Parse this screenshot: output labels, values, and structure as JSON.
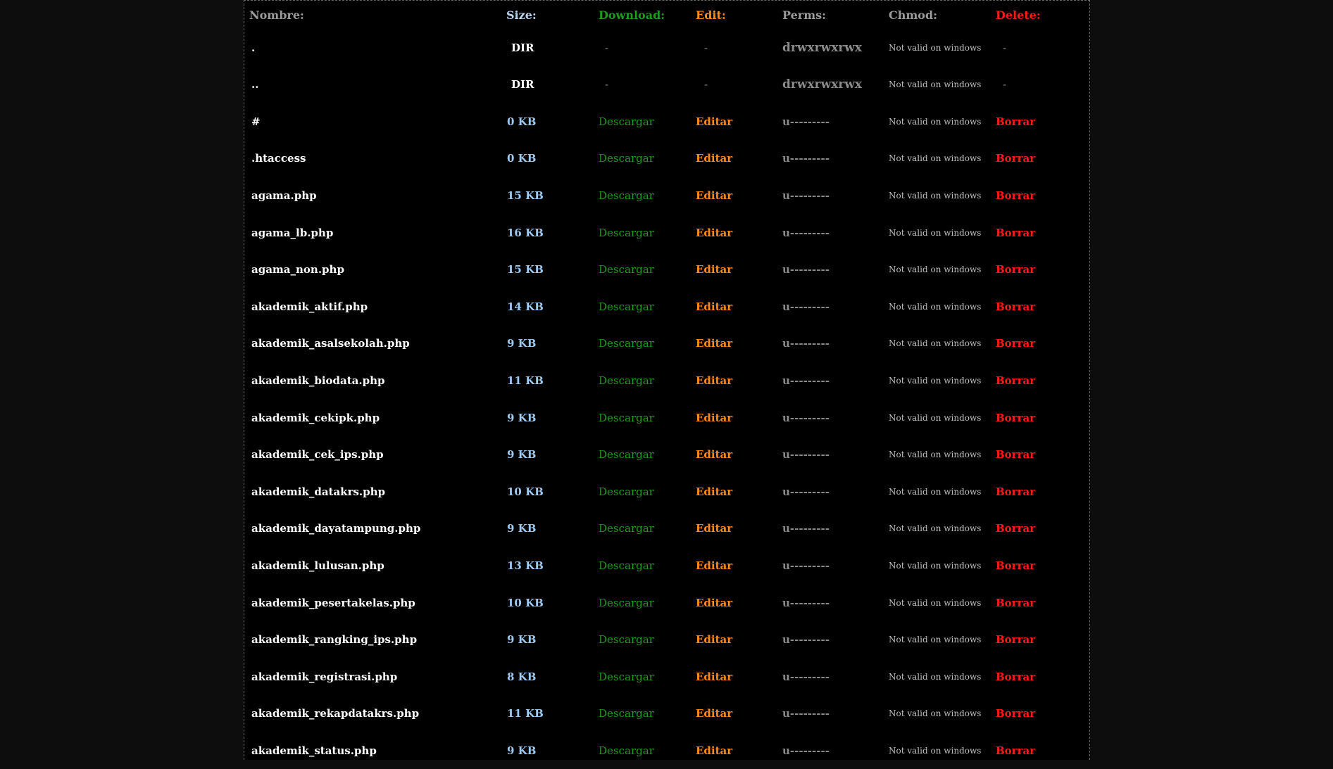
{
  "headers": {
    "name": "Nombre:",
    "size": "Size:",
    "download": "Download:",
    "edit": "Edit:",
    "perms": "Perms:",
    "chmod": "Chmod:",
    "delete": "Delete:"
  },
  "rows": [
    {
      "name": ".",
      "size": "DIR",
      "download": "-",
      "edit": "-",
      "perms": "drwxrwxrwx",
      "chmod": "Not valid on windows",
      "delete": "-"
    },
    {
      "name": "..",
      "size": "DIR",
      "download": "-",
      "edit": "-",
      "perms": "drwxrwxrwx",
      "chmod": "Not valid on windows",
      "delete": "-"
    },
    {
      "name": "#",
      "size": "0 KB",
      "download": "Descargar",
      "edit": "Editar",
      "perms": "u---------",
      "chmod": "Not valid on windows",
      "delete": "Borrar"
    },
    {
      "name": ".htaccess",
      "size": "0 KB",
      "download": "Descargar",
      "edit": "Editar",
      "perms": "u---------",
      "chmod": "Not valid on windows",
      "delete": "Borrar"
    },
    {
      "name": "agama.php",
      "size": "15 KB",
      "download": "Descargar",
      "edit": "Editar",
      "perms": "u---------",
      "chmod": "Not valid on windows",
      "delete": "Borrar"
    },
    {
      "name": "agama_lb.php",
      "size": "16 KB",
      "download": "Descargar",
      "edit": "Editar",
      "perms": "u---------",
      "chmod": "Not valid on windows",
      "delete": "Borrar"
    },
    {
      "name": "agama_non.php",
      "size": "15 KB",
      "download": "Descargar",
      "edit": "Editar",
      "perms": "u---------",
      "chmod": "Not valid on windows",
      "delete": "Borrar"
    },
    {
      "name": "akademik_aktif.php",
      "size": "14 KB",
      "download": "Descargar",
      "edit": "Editar",
      "perms": "u---------",
      "chmod": "Not valid on windows",
      "delete": "Borrar"
    },
    {
      "name": "akademik_asalsekolah.php",
      "size": "9 KB",
      "download": "Descargar",
      "edit": "Editar",
      "perms": "u---------",
      "chmod": "Not valid on windows",
      "delete": "Borrar"
    },
    {
      "name": "akademik_biodata.php",
      "size": "11 KB",
      "download": "Descargar",
      "edit": "Editar",
      "perms": "u---------",
      "chmod": "Not valid on windows",
      "delete": "Borrar"
    },
    {
      "name": "akademik_cekipk.php",
      "size": "9 KB",
      "download": "Descargar",
      "edit": "Editar",
      "perms": "u---------",
      "chmod": "Not valid on windows",
      "delete": "Borrar"
    },
    {
      "name": "akademik_cek_ips.php",
      "size": "9 KB",
      "download": "Descargar",
      "edit": "Editar",
      "perms": "u---------",
      "chmod": "Not valid on windows",
      "delete": "Borrar"
    },
    {
      "name": "akademik_datakrs.php",
      "size": "10 KB",
      "download": "Descargar",
      "edit": "Editar",
      "perms": "u---------",
      "chmod": "Not valid on windows",
      "delete": "Borrar"
    },
    {
      "name": "akademik_dayatampung.php",
      "size": "9 KB",
      "download": "Descargar",
      "edit": "Editar",
      "perms": "u---------",
      "chmod": "Not valid on windows",
      "delete": "Borrar"
    },
    {
      "name": "akademik_lulusan.php",
      "size": "13 KB",
      "download": "Descargar",
      "edit": "Editar",
      "perms": "u---------",
      "chmod": "Not valid on windows",
      "delete": "Borrar"
    },
    {
      "name": "akademik_pesertakelas.php",
      "size": "10 KB",
      "download": "Descargar",
      "edit": "Editar",
      "perms": "u---------",
      "chmod": "Not valid on windows",
      "delete": "Borrar"
    },
    {
      "name": "akademik_rangking_ips.php",
      "size": "9 KB",
      "download": "Descargar",
      "edit": "Editar",
      "perms": "u---------",
      "chmod": "Not valid on windows",
      "delete": "Borrar"
    },
    {
      "name": "akademik_registrasi.php",
      "size": "8 KB",
      "download": "Descargar",
      "edit": "Editar",
      "perms": "u---------",
      "chmod": "Not valid on windows",
      "delete": "Borrar"
    },
    {
      "name": "akademik_rekapdatakrs.php",
      "size": "11 KB",
      "download": "Descargar",
      "edit": "Editar",
      "perms": "u---------",
      "chmod": "Not valid on windows",
      "delete": "Borrar"
    },
    {
      "name": "akademik_status.php",
      "size": "9 KB",
      "download": "Descargar",
      "edit": "Editar",
      "perms": "u---------",
      "chmod": "Not valid on windows",
      "delete": "Borrar"
    }
  ]
}
